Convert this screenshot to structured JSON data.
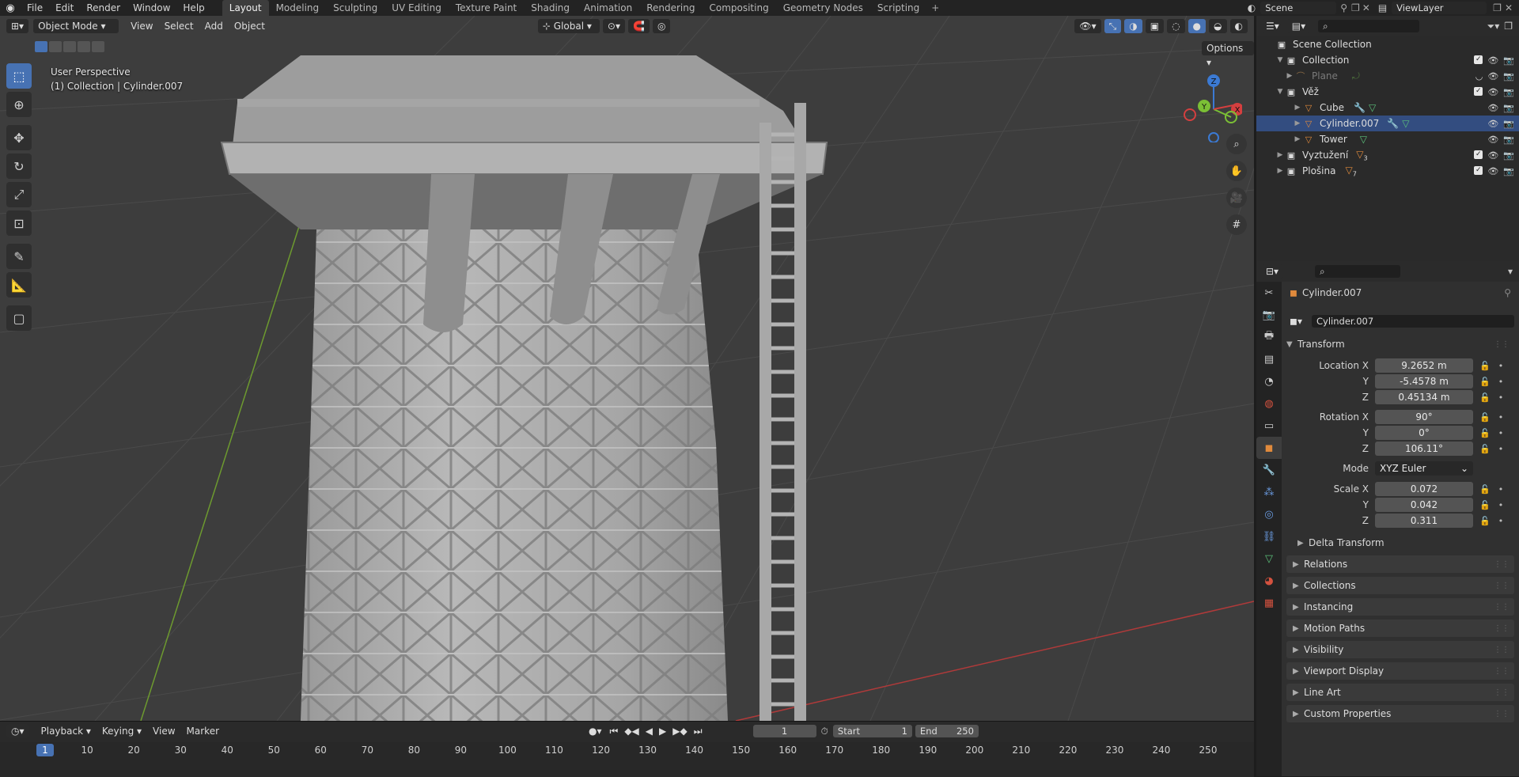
{
  "topbar": {
    "menus": [
      "File",
      "Edit",
      "Render",
      "Window",
      "Help"
    ],
    "workspaces": [
      "Layout",
      "Modeling",
      "Sculpting",
      "UV Editing",
      "Texture Paint",
      "Shading",
      "Animation",
      "Rendering",
      "Compositing",
      "Geometry Nodes",
      "Scripting"
    ],
    "active_workspace": "Layout",
    "scene": "Scene",
    "view_layer": "ViewLayer"
  },
  "viewport": {
    "mode": "Object Mode",
    "menus": [
      "View",
      "Select",
      "Add",
      "Object"
    ],
    "orientation": "Global",
    "options": "Options",
    "info_line1": "User Perspective",
    "info_line2": "(1) Collection | Cylinder.007",
    "gizmo": {
      "x": "X",
      "y": "Y",
      "z": "Z"
    }
  },
  "timeline": {
    "menus": [
      "Playback",
      "Keying",
      "View",
      "Marker"
    ],
    "current_frame": "1",
    "start_label": "Start",
    "start": "1",
    "end_label": "End",
    "end": "250",
    "ticks": [
      "1",
      "10",
      "20",
      "30",
      "40",
      "50",
      "60",
      "70",
      "80",
      "90",
      "100",
      "110",
      "120",
      "130",
      "140",
      "150",
      "160",
      "170",
      "180",
      "190",
      "200",
      "210",
      "220",
      "230",
      "240",
      "250"
    ]
  },
  "outliner": {
    "rows": [
      {
        "label": "Scene Collection",
        "type": "scene"
      },
      {
        "label": "Collection",
        "type": "collection"
      },
      {
        "label": "Plane",
        "type": "object",
        "dim": true
      },
      {
        "label": "Věž",
        "type": "collection"
      },
      {
        "label": "Cube",
        "type": "object"
      },
      {
        "label": "Cylinder.007",
        "type": "object",
        "selected": true
      },
      {
        "label": "Tower",
        "type": "object"
      },
      {
        "label": "Vyztužení",
        "type": "collection",
        "count": "3"
      },
      {
        "label": "Plošina",
        "type": "collection",
        "count": "7"
      }
    ]
  },
  "properties": {
    "object_name": "Cylinder.007",
    "data_name": "Cylinder.007",
    "transform_label": "Transform",
    "location_label": "Location X",
    "location": [
      "9.2652 m",
      "-5.4578 m",
      "0.45134 m"
    ],
    "rotation_label": "Rotation X",
    "rotation": [
      "90°",
      "0°",
      "106.11°"
    ],
    "mode_label": "Mode",
    "mode": "XYZ Euler",
    "scale_label": "Scale X",
    "scale": [
      "0.072",
      "0.042",
      "0.311"
    ],
    "y_label": "Y",
    "z_label": "Z",
    "delta": "Delta Transform",
    "panels": [
      "Relations",
      "Collections",
      "Instancing",
      "Motion Paths",
      "Visibility",
      "Viewport Display",
      "Line Art",
      "Custom Properties"
    ]
  },
  "colors": {
    "accent": "#4772b3",
    "x_axis": "#d43f3f",
    "y_axis": "#7bbf35",
    "z_axis": "#3b7ad4",
    "object_orange": "#e08a3c"
  }
}
